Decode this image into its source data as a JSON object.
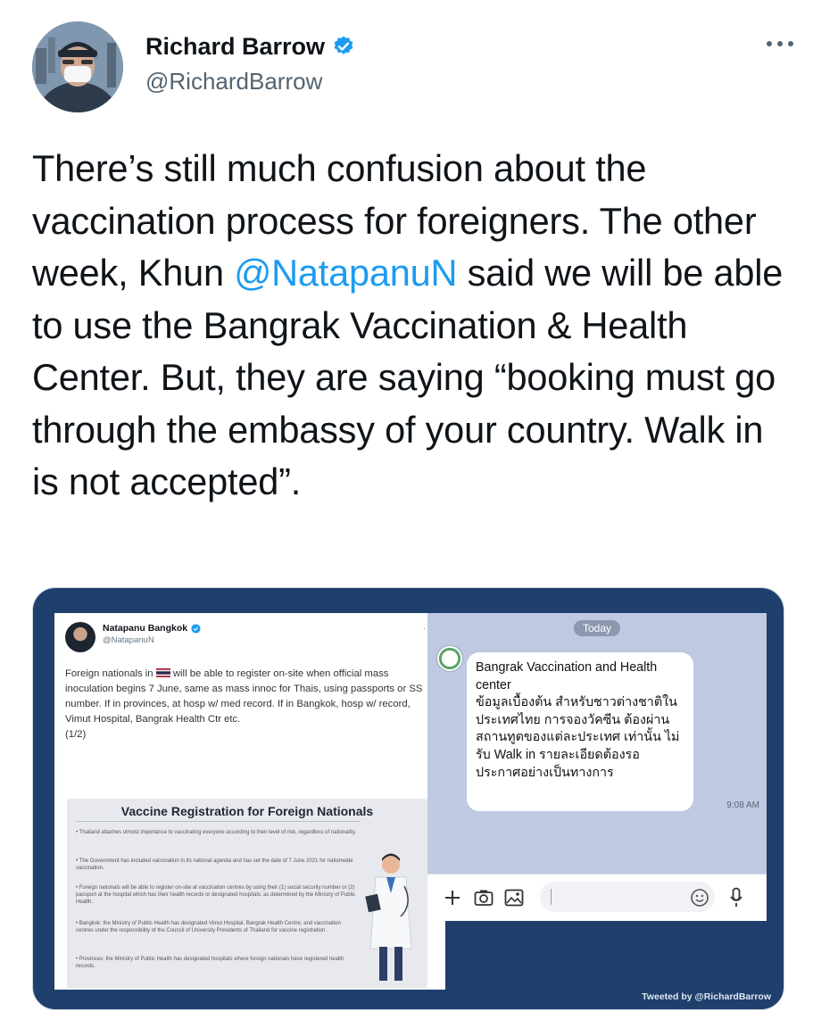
{
  "author": {
    "display_name": "Richard Barrow",
    "handle": "@RichardBarrow",
    "verified": true,
    "avatar_icon": "user-avatar"
  },
  "more_menu_icon": "more-horizontal-icon",
  "tweet": {
    "text_before_mention": "There’s still much confusion about the vaccination process for foreigners. The other week, Khun ",
    "mention": "@NatapanuN",
    "text_after_mention": " said we will be able to use the Bangrak Vaccination & Health Center. But, they are saying “booking must go through the embassy of your country. Walk in is not accepted”."
  },
  "media": {
    "left": {
      "name": "Natapanu Bangkok",
      "handle": "@NatapanuN",
      "text_a": "Foreign nationals in",
      "text_b": " will be able to register on-site when official mass inoculation begins 7 June, same as mass innoc for Thais, using passports or SS number. If in provinces, at hosp w/ med record. If in Bangkok, hosp w/ record, Vimut Hospital, Bangrak Health Ctr etc.",
      "page": "(1/2)",
      "infographic_title": "Vaccine Registration for Foreign Nationals",
      "bullets": [
        "• Thailand attaches utmost importance to vaccinating everyone according to their level of risk, regardless of nationality.",
        "• The Government has included vaccination in its national agenda and has set the date of 7 June 2021 for nationwide vaccination.",
        "• Foreign nationals will be able to register on-site at vaccination centres by using their (1) social security number or (2) passport at the hospital which has their health records or designated hospitals, as determined by the Ministry of Public Health.",
        "• Bangkok: the Ministry of Public Health has designated Vimut Hospital, Bangrak Health Centre, and vaccination centres under the responsibility of the Council of University Presidents of Thailand for vaccine registration.",
        "• Provinces: the Ministry of Public Health has designated hospitals where foreign nationals have registered health records."
      ]
    },
    "right": {
      "date_pill": "Today",
      "sender": "Bangrak Vaccination and Health center",
      "message_thai": "ข้อมูลเบื้องต้น สำหรับชาวต่างชาติในประเทศไทย การจองวัคซีน ต้องผ่านสถานทูตของแต่ละประเทศ เท่านั้น ไม่รับ Walk in รายละเอียดต้องรอ ประกาศอย่างเป็นทางการ",
      "time": "9:08 AM"
    },
    "watermark": "Tweeted by @RichardBarrow"
  }
}
